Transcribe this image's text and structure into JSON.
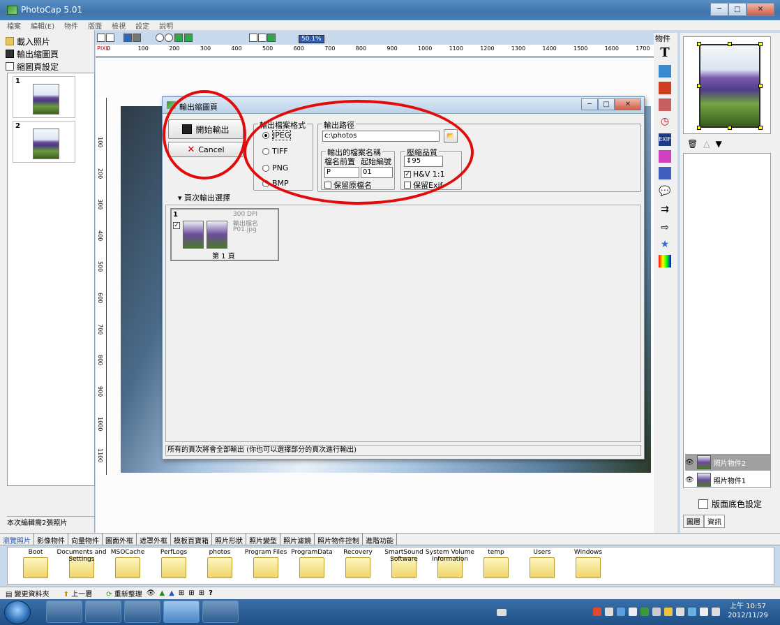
{
  "app": {
    "title": "PhotoCap 5.01",
    "window_buttons": [
      "─",
      "□",
      "✕"
    ]
  },
  "menu": [
    "檔案",
    "編輯(E)",
    "物件",
    "版面",
    "檢視",
    "設定",
    "說明"
  ],
  "left_panel": {
    "items": [
      {
        "label": "載入照片",
        "icon": "folder-open-icon"
      },
      {
        "label": "輸出縮圖頁",
        "icon": "save-disk-icon"
      },
      {
        "label": "縮圖頁設定",
        "icon": "page-settings-icon"
      }
    ],
    "thumbnail_numbers": [
      "1",
      "2"
    ],
    "status": "本次編輯需2張照片"
  },
  "toolbar": {
    "zoom": "50.1%"
  },
  "ruler": {
    "unit_label": "PIXL",
    "h_ticks": [
      "0",
      "100",
      "200",
      "300",
      "400",
      "500",
      "600",
      "700",
      "800",
      "900",
      "1000",
      "1100",
      "1200",
      "1300",
      "1400",
      "1500",
      "1600",
      "1700"
    ],
    "v_ticks": [
      "100",
      "200",
      "300",
      "400",
      "500",
      "600",
      "700",
      "800",
      "900",
      "1000",
      "1100"
    ]
  },
  "right_objects": {
    "header": "物件"
  },
  "right_panel": {
    "layers": [
      {
        "name": "照片物件2",
        "selected": true
      },
      {
        "name": "照片物件1",
        "selected": false
      }
    ],
    "bg_setting_label": "版面底色設定",
    "tabs": [
      "圖層",
      "資訊"
    ]
  },
  "dialog": {
    "title": "輸出縮圖頁",
    "start_button": "開始輸出",
    "cancel_button": "Cancel",
    "format": {
      "legend": "輸出檔案格式",
      "options": [
        "JPEG",
        "TIFF",
        "PNG",
        "BMP"
      ],
      "selected": "JPEG"
    },
    "output_path": {
      "legend": "輸出路徑",
      "value": "c:\\photos"
    },
    "filename": {
      "legend": "輸出的檔案名稱",
      "prefix_label": "檔名前置",
      "start_label": "起始編號",
      "prefix_value": "P",
      "start_value": "01",
      "keep_original_label": "保留原檔名",
      "keep_original_checked": false
    },
    "quality": {
      "legend": "壓縮品質",
      "value": "95",
      "hv_label": "H&V 1:1",
      "hv_checked": true,
      "keep_exif_label": "保留Exif",
      "keep_exif_checked": false
    },
    "page_select_label": "▾ 頁次輸出選擇",
    "page_card": {
      "number": "1",
      "dpi": "300 DPI",
      "out_name_label": "輸出檔名",
      "file": "P01.jpg",
      "page_label": "第 1 頁",
      "checked": true
    },
    "status": "所有的頁次將會全部輸出 (你也可以選擇部分的頁次進行輸出)"
  },
  "bottom_tabs": [
    "瀏覽照片",
    "影像物件",
    "向量物件",
    "圖面外框",
    "遮罩外框",
    "模板百寶箱",
    "照片形狀",
    "照片變型",
    "照片濾鏡",
    "照片物件控制",
    "進階功能"
  ],
  "folders": [
    "Boot",
    "Documents and Settings",
    "MSOCache",
    "PerfLogs",
    "photos",
    "Program Files",
    "ProgramData",
    "Recovery",
    "SmartSound Software",
    "System Volume Information",
    "temp",
    "Users",
    "Windows"
  ],
  "bottom_toolbar": {
    "change_folder": "變更資料夾",
    "up_level": "上一層",
    "refresh": "重新整理",
    "help": "?"
  },
  "taskbar": {
    "time": "上午 10:57",
    "date": "2012/11/29"
  },
  "colors": {
    "annotation_red": "#e20b0b",
    "title_blue": "#3f74ad",
    "active_tab": "#2a56b0"
  }
}
